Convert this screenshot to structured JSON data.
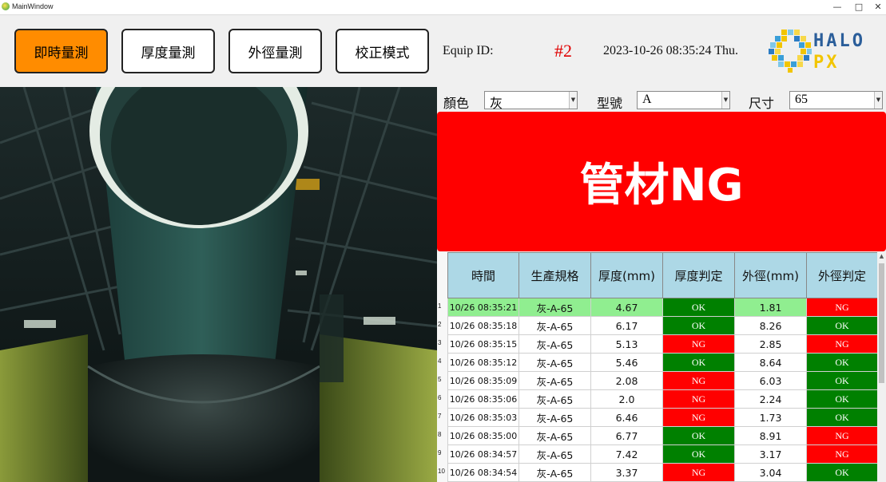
{
  "window": {
    "title": "MainWindow",
    "minimize": "—",
    "maximize": "□",
    "close": "✕"
  },
  "mode_buttons": [
    {
      "label": "即時量測",
      "active": true
    },
    {
      "label": "厚度量測",
      "active": false
    },
    {
      "label": "外徑量測",
      "active": false
    },
    {
      "label": "校正模式",
      "active": false
    }
  ],
  "equip": {
    "label": "Equip ID:",
    "value": "#2"
  },
  "datetime": "2023-10-26 08:35:24 Thu.",
  "logo": {
    "line1": "HALO",
    "line2": "PX"
  },
  "selectors": [
    {
      "label": "顏色",
      "value": "灰"
    },
    {
      "label": "型號",
      "value": "A"
    },
    {
      "label": "尺寸",
      "value": "65"
    }
  ],
  "result_banner": "管材NG",
  "table": {
    "headers": [
      "時間",
      "生產規格",
      "厚度(mm)",
      "厚度判定",
      "外徑(mm)",
      "外徑判定"
    ],
    "rows": [
      {
        "n": "1",
        "time": "10/26 08:35:21",
        "spec": "灰-A-65",
        "thick": "4.67",
        "thick_judge": "OK",
        "od": "1.81",
        "od_judge": "NG"
      },
      {
        "n": "2",
        "time": "10/26 08:35:18",
        "spec": "灰-A-65",
        "thick": "6.17",
        "thick_judge": "OK",
        "od": "8.26",
        "od_judge": "OK"
      },
      {
        "n": "3",
        "time": "10/26 08:35:15",
        "spec": "灰-A-65",
        "thick": "5.13",
        "thick_judge": "NG",
        "od": "2.85",
        "od_judge": "NG"
      },
      {
        "n": "4",
        "time": "10/26 08:35:12",
        "spec": "灰-A-65",
        "thick": "5.46",
        "thick_judge": "OK",
        "od": "8.64",
        "od_judge": "OK"
      },
      {
        "n": "5",
        "time": "10/26 08:35:09",
        "spec": "灰-A-65",
        "thick": "2.08",
        "thick_judge": "NG",
        "od": "6.03",
        "od_judge": "OK"
      },
      {
        "n": "6",
        "time": "10/26 08:35:06",
        "spec": "灰-A-65",
        "thick": "2.0",
        "thick_judge": "NG",
        "od": "2.24",
        "od_judge": "OK"
      },
      {
        "n": "7",
        "time": "10/26 08:35:03",
        "spec": "灰-A-65",
        "thick": "6.46",
        "thick_judge": "NG",
        "od": "1.73",
        "od_judge": "OK"
      },
      {
        "n": "8",
        "time": "10/26 08:35:00",
        "spec": "灰-A-65",
        "thick": "6.77",
        "thick_judge": "OK",
        "od": "8.91",
        "od_judge": "NG"
      },
      {
        "n": "9",
        "time": "10/26 08:34:57",
        "spec": "灰-A-65",
        "thick": "7.42",
        "thick_judge": "OK",
        "od": "3.17",
        "od_judge": "NG"
      },
      {
        "n": "10",
        "time": "10/26 08:34:54",
        "spec": "灰-A-65",
        "thick": "3.37",
        "thick_judge": "NG",
        "od": "3.04",
        "od_judge": "OK"
      }
    ]
  },
  "colors": {
    "ok": "#008000",
    "ng": "#ff0000",
    "active_button": "#ff8c00",
    "header": "#add8e6",
    "highlight_row": "#90ee90"
  }
}
